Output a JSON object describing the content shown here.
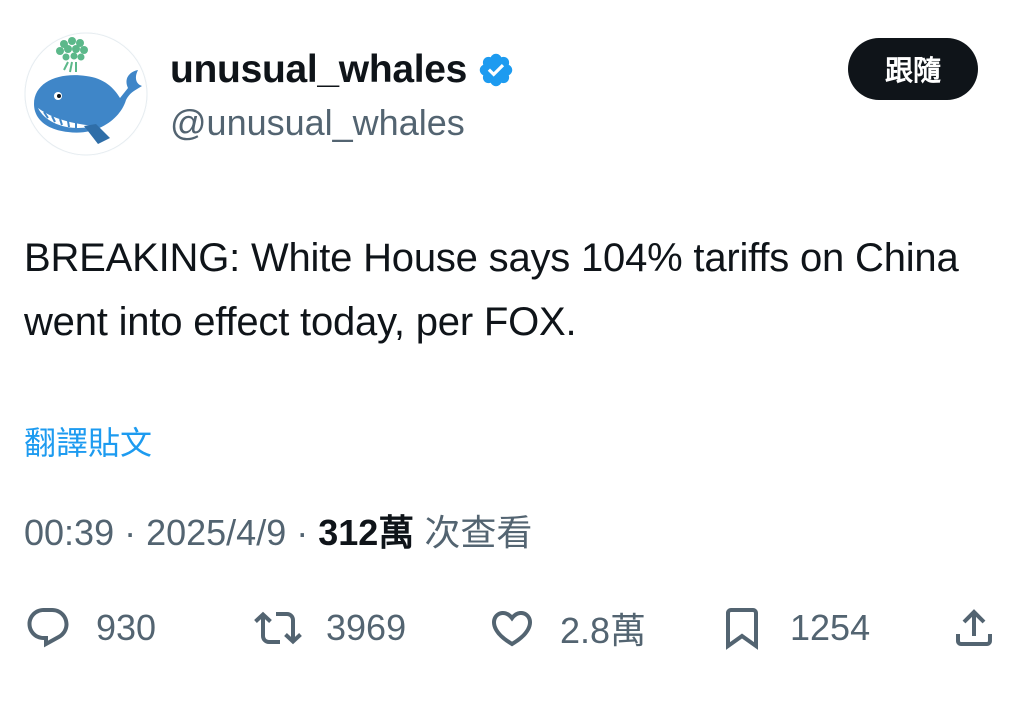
{
  "author": {
    "display_name": "unusual_whales",
    "handle": "@unusual_whales",
    "avatar_icon": "whale-logo-icon",
    "verified_icon": "verified-badge-icon",
    "verified_color": "#1d9bf0"
  },
  "follow_button": {
    "label": "跟隨"
  },
  "tweet": {
    "text": "BREAKING: White House says 104% tariffs on China went into effect today, per FOX.",
    "translate_label": "翻譯貼文"
  },
  "meta": {
    "time": "00:39",
    "separator": " · ",
    "date": "2025/4/9",
    "views_count": "312萬",
    "views_label": "次查看"
  },
  "actions": {
    "reply": {
      "icon": "reply-icon",
      "count": "930"
    },
    "repost": {
      "icon": "repost-icon",
      "count": "3969"
    },
    "like": {
      "icon": "heart-icon",
      "count": "2.8萬"
    },
    "bookmark": {
      "icon": "bookmark-icon",
      "count": "1254"
    },
    "share": {
      "icon": "share-icon"
    }
  },
  "colors": {
    "text_primary": "#0f1419",
    "text_secondary": "#536471",
    "link": "#1d9bf0",
    "button_bg": "#0f1419"
  }
}
